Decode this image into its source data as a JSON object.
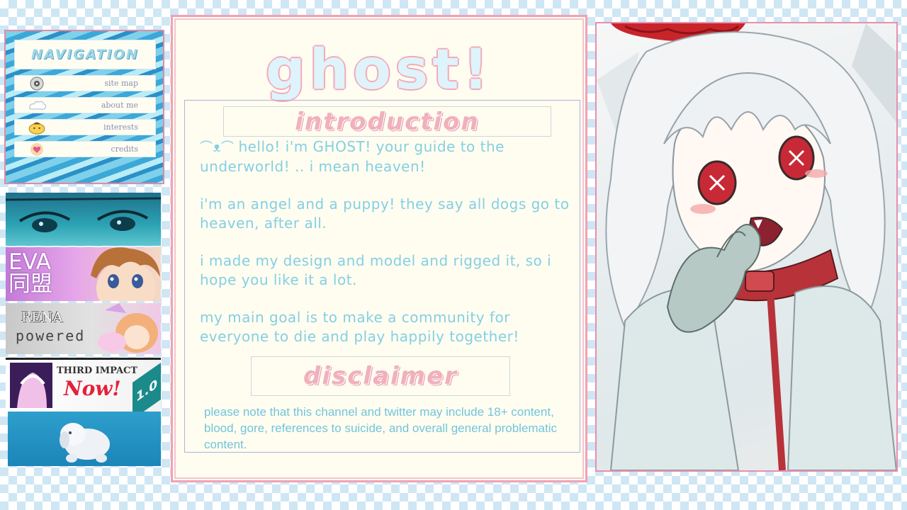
{
  "navigation": {
    "title": "NAVIGATION",
    "items": [
      {
        "label": "site map",
        "icon": "disc-icon"
      },
      {
        "label": "about me",
        "icon": "cloud-icon"
      },
      {
        "label": "interests",
        "icon": "pompompurin-icon"
      },
      {
        "label": "credits",
        "icon": "heart-icon"
      }
    ]
  },
  "banners": {
    "eva": {
      "line1": "EVA",
      "line2": "同盟"
    },
    "rena": {
      "line1": "RENA",
      "line2": "powered"
    },
    "third_impact": {
      "heading": "THIRD IMPACT",
      "now": "Now!",
      "version": "1.0"
    }
  },
  "main": {
    "title": "ghost!",
    "introduction_heading": "introduction",
    "intro_swirl": "⌒ᴥ⌒",
    "paragraphs": [
      "hello! i'm GHOST! your guide to the underworld! .. i mean heaven!",
      "i'm an angel and a puppy! they say all dogs go to heaven, after all.",
      "i made my design and model and rigged it, so i hope you like it a lot.",
      "my main goal is to make a community for everyone to die and play happily together!"
    ],
    "disclaimer_heading": "disclaimer",
    "disclaimer_text": "please note that this channel and twitter may include 18+ content, blood, gore, references to suicide, and overall general problematic content."
  },
  "colors": {
    "accent_pink": "#f0a2b5",
    "text_cyan": "#84cfe4",
    "checker_blue": "#cfe6f4",
    "card_cream": "#fffdf0"
  }
}
